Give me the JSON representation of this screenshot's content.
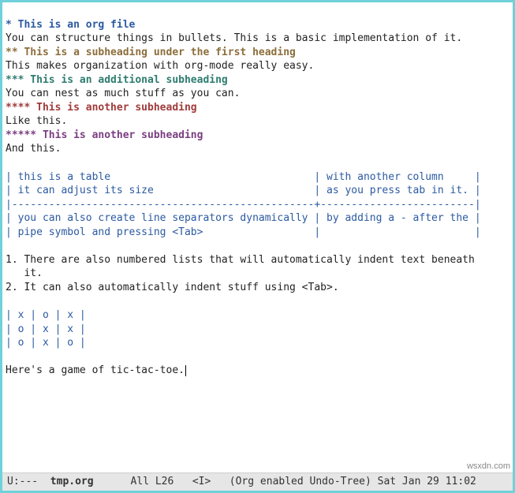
{
  "headings": {
    "h1": "* This is an org file",
    "h1_body": "You can structure things in bullets. This is a basic implementation of it.",
    "h2": "** This is a subheading under the first heading",
    "h2_body": "This makes organization with org-mode really easy.",
    "h3": "*** This is an additional subheading",
    "h3_body": "You can nest as much stuff as you can.",
    "h4": "**** This is another subheading",
    "h4_body": "Like this.",
    "h5": "***** This is another subheading",
    "h5_body": "And this."
  },
  "table1": {
    "r1": "| this is a table                                 | with another column     |",
    "r2": "| it can adjust its size                          | as you press tab in it. |",
    "sep": "|-------------------------------------------------+-------------------------|",
    "r3": "| you can also create line separators dynamically | by adding a - after the |",
    "r4": "| pipe symbol and pressing <Tab>                  |                         |"
  },
  "list": {
    "i1a": "1. There are also numbered lists that will automatically indent text beneath",
    "i1b": "   it.",
    "i2": "2. It can also automatically indent stuff using <Tab>."
  },
  "table2": {
    "r1": "| x | o | x |",
    "r2": "| o | x | x |",
    "r3": "| o | x | o |"
  },
  "footer_text": "Here's a game of tic-tac-toe.",
  "modeline": {
    "left": "U:--- ",
    "file": " tmp.org",
    "pos": "      All L26   <I>   (Org enabled Undo-Tree) Sat Jan 29 11:02"
  },
  "watermark": "wsxdn.com"
}
